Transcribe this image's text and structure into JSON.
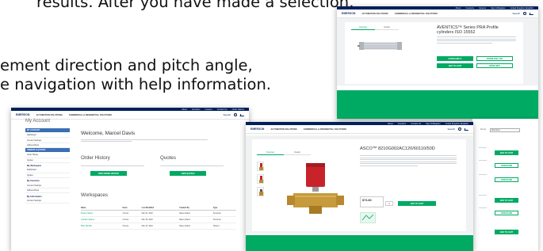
{
  "slide": {
    "line1": "results. After you have made a selection,",
    "line2": "ement direction and pitch angle,",
    "line3": "e navigation with help information."
  },
  "brand": {
    "logo": "EMERSON",
    "green": "#00aa63",
    "navy": "#00205b"
  },
  "nav": {
    "automation": "AUTOMATION SOLUTIONS",
    "commercial": "COMMERCIAL & RESIDENTIAL SOLUTIONS",
    "search": "Search",
    "utility": [
      "About",
      "Investors",
      "Careers",
      "Contact Us",
      "Sign In/Register",
      "Order History",
      "United Kingdom (English)"
    ]
  },
  "product_window": {
    "title": "AVENTICS™ Series PRA Profile cylinders ISO 15552",
    "tabs": [
      "Overview",
      "Details"
    ],
    "buttons": [
      "CONFIGURE IT",
      "DOWNLOAD CAD",
      "ADD TO CART",
      "MORE INFO"
    ]
  },
  "account_window": {
    "partial_title": "My Account",
    "welcome": "Welcome, Marcel Davis",
    "order_history": "Order History",
    "quotes": "Quotes",
    "view_order_history": "VIEW ORDER HISTORY",
    "view_quotes": "VIEW QUOTES",
    "workspaces": "Workspaces",
    "sidebar": {
      "sections": [
        {
          "head": "MY ACCOUNT",
          "items": [
            "Dashboard",
            "Account Settings",
            "Address Book"
          ]
        },
        {
          "head": "ORDERS & QUOTES",
          "items": [
            "Order History",
            "Quotes"
          ]
        }
      ],
      "groups": [
        "My Workspace",
        "My Favorites",
        "My Information"
      ]
    },
    "table": {
      "columns": [
        "Name",
        "Items",
        "Last Modified",
        "Created By",
        "Type"
      ],
      "rows": [
        [
          "Project Valves",
          "4 Items",
          "Mar 22, 2022",
          "Marcel Davis",
          "Personal"
        ],
        [
          "Cylinder Spares",
          "2 Items",
          "Mar 18, 2022",
          "Marcel Davis",
          "Personal"
        ],
        [
          "Plant Retrofit",
          "6 Items",
          "Mar 10, 2022",
          "Marcel Davis",
          "Shared"
        ]
      ]
    }
  },
  "valve_window": {
    "title": "ASCO™ 8210G002AC120/60110/50D",
    "tabs": [
      "Overview",
      "Details"
    ],
    "price": "$73.83",
    "qty": "1",
    "add_to_cart": "ADD TO CART"
  },
  "list_strip": {
    "sort_label": "Sort by",
    "sort_value": "Relevance",
    "buttons": [
      "ADD TO CART",
      "CONFIGURE",
      "ADD TO CART",
      "CONFIGURE"
    ]
  }
}
